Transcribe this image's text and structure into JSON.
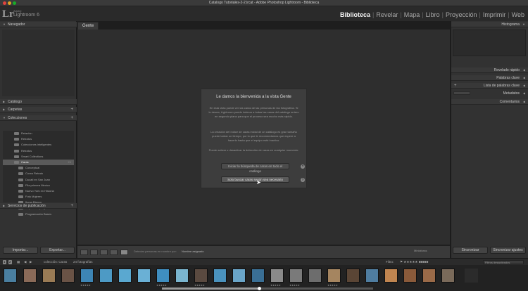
{
  "window": {
    "title": "Catalogo Tutoriales-2-2.lrcat - Adobe Photoshop Lightroom - Biblioteca"
  },
  "identity": {
    "logo": "Lr",
    "adobe": "Adobe",
    "product": "Lightroom 6"
  },
  "modules": [
    "Biblioteca",
    "Revelar",
    "Mapa",
    "Libro",
    "Proyección",
    "Imprimir",
    "Web"
  ],
  "left_panel": {
    "navigator": "Navegador",
    "catalog": "Catálogo",
    "folders": "Carpetas",
    "collections": "Colecciones",
    "collection_items": [
      {
        "name": "Relación",
        "count": ""
      },
      {
        "name": "Retratos",
        "count": ""
      },
      {
        "name": "Colecciones inteligentes",
        "count": ""
      },
      {
        "name": "Retratos",
        "count": ""
      },
      {
        "name": "Smart Collections",
        "count": ""
      },
      {
        "name": "Caras",
        "count": "24"
      },
      {
        "name": "Conceptual",
        "count": ""
      },
      {
        "name": "Corea Retrato",
        "count": ""
      },
      {
        "name": "Ducati en San Juan",
        "count": ""
      },
      {
        "name": "Fila primera Mexico",
        "count": ""
      },
      {
        "name": "Nuevo York en Historia",
        "count": ""
      },
      {
        "name": "Foto Mujeres",
        "count": ""
      },
      {
        "name": "Ikona Blanco",
        "count": ""
      },
      {
        "name": "Mi primera programación",
        "count": ""
      },
      {
        "name": "Programación Bases",
        "count": ""
      }
    ],
    "publish": "Servicios de publicación",
    "import_btn": "Importar...",
    "export_btn": "Exportar..."
  },
  "center": {
    "tab": "Gente",
    "dialog": {
      "title": "Le damos la bienvenida a la vista Gente",
      "p1": "En esta vista puede ver las caras de las personas de las fotografías. Si lo desea, Lightroom puede indexar a todas las caras del catálogo entero en segundo plano para que el proceso sea mucho más rápido.",
      "p2": "La creación del índice de caras inicial de un catálogo es gran tamaño puede tardar un tiempo, por lo que le recomendamos que espere a hacerlo hasta que el equipo esté inactivo.",
      "p3": "Puede activar o desactivar la detección de caras en cualquier momento.",
      "btn1": "Iniciar la búsqueda de caras en todo el catálogo",
      "btn2": "Solo buscar caras según sea necesario",
      "help": "?"
    }
  },
  "right_panel": {
    "histogram": "Histograma",
    "quick_develop": "Revelado rápido",
    "keywording": "Palabras clave",
    "keyword_list": "Lista de palabras clave",
    "metadata": "Metadatos",
    "comments": "Comentarios",
    "sync": "Sincronizar",
    "sync_settings": "Sincronizar ajustes"
  },
  "toolbar": {
    "hint": "Detectar personas en nombre por:",
    "sort": "Nombre asignado",
    "mini_label": "Miniaturas"
  },
  "filmstrip_bar": {
    "page1": "1",
    "page2": "2",
    "source": "colección: Caras",
    "count": "24 fotografías",
    "filter_label": "Filtro:",
    "filter_value": "Filtros desactivados"
  },
  "colors": {
    "bg": "#1e1e1e",
    "panel": "#323232",
    "active_module": "#f2f2f2"
  },
  "filmstrip": {
    "progress": 0.46
  }
}
